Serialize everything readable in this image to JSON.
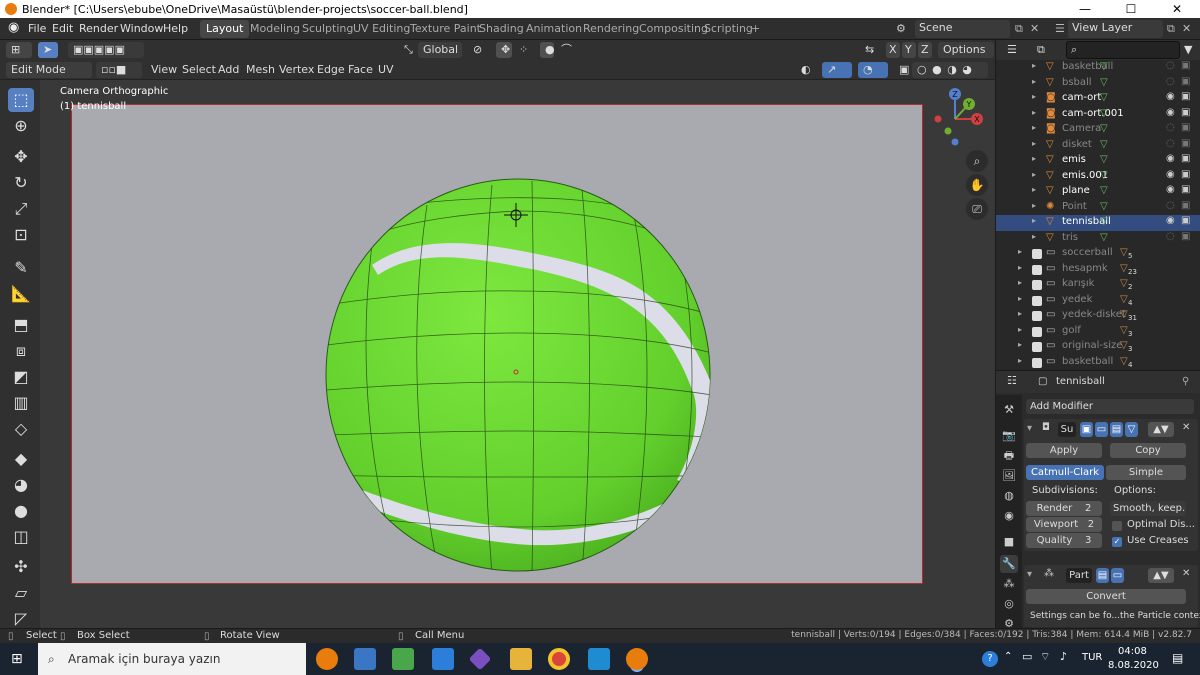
{
  "window": {
    "title": "Blender* [C:\\Users\\ebube\\OneDrive\\Masaüstü\\blender-projects\\soccer-ball.blend]",
    "controls": [
      "—",
      "☐",
      "✕"
    ]
  },
  "topbar": {
    "menus": [
      "File",
      "Edit",
      "Render",
      "Window",
      "Help"
    ],
    "workspaces": [
      "Layout",
      "Modeling",
      "Sculpting",
      "UV Editing",
      "Texture Paint",
      "Shading",
      "Animation",
      "Rendering",
      "Compositing",
      "Scripting"
    ],
    "active_workspace": "Layout",
    "add_workspace": "+",
    "scene": "Scene",
    "view_layer": "View Layer"
  },
  "viewport_header1": {
    "transform_orientation": "Global",
    "axis_x": "X",
    "axis_y": "Y",
    "axis_z": "Z",
    "options": "Options"
  },
  "viewport_header2": {
    "mode": "Edit Mode",
    "menus": [
      "View",
      "Select",
      "Add",
      "Mesh",
      "Vertex",
      "Edge",
      "Face",
      "UV"
    ]
  },
  "viewport": {
    "camera_label": "Camera Orthographic",
    "object_label": "(1) tennisball",
    "gizmo": {
      "x": "X",
      "y": "Y",
      "z": "Z"
    }
  },
  "outliner": {
    "search_placeholder": "",
    "rows": [
      {
        "name": "basketball",
        "type": "mesh",
        "visible": false,
        "badge": ""
      },
      {
        "name": "bsball",
        "type": "mesh",
        "visible": false,
        "badge": ""
      },
      {
        "name": "cam-ort",
        "type": "camera",
        "visible": true,
        "badge": ""
      },
      {
        "name": "cam-ort.001",
        "type": "camera",
        "visible": true,
        "badge": ""
      },
      {
        "name": "Camera",
        "type": "camera",
        "visible": false,
        "badge": ""
      },
      {
        "name": "disket",
        "type": "mesh",
        "visible": false,
        "badge": ""
      },
      {
        "name": "emis",
        "type": "mesh",
        "visible": true,
        "badge": ""
      },
      {
        "name": "emis.001",
        "type": "mesh",
        "visible": true,
        "badge": ""
      },
      {
        "name": "plane",
        "type": "mesh",
        "visible": true,
        "badge": ""
      },
      {
        "name": "Point",
        "type": "light",
        "visible": false,
        "badge": ""
      },
      {
        "name": "tennisball",
        "type": "mesh",
        "visible": true,
        "badge": "",
        "selected": true
      },
      {
        "name": "tris",
        "type": "mesh",
        "visible": false,
        "badge": ""
      },
      {
        "name": "soccerball",
        "type": "collection",
        "visible": false,
        "badge": "5"
      },
      {
        "name": "hesapmk",
        "type": "collection",
        "visible": false,
        "badge": "23"
      },
      {
        "name": "karışık",
        "type": "collection",
        "visible": false,
        "badge": "2"
      },
      {
        "name": "yedek",
        "type": "collection",
        "visible": false,
        "badge": "4"
      },
      {
        "name": "yedek-disket",
        "type": "collection",
        "visible": false,
        "badge": "31"
      },
      {
        "name": "golf",
        "type": "collection",
        "visible": false,
        "badge": "3"
      },
      {
        "name": "original-size",
        "type": "collection",
        "visible": false,
        "badge": "3"
      },
      {
        "name": "basketball",
        "type": "collection",
        "visible": false,
        "badge": "4"
      }
    ]
  },
  "properties": {
    "object_name": "tennisball",
    "add_modifier": "Add Modifier",
    "subsurf": {
      "name_short": "Su",
      "apply": "Apply",
      "copy": "Copy",
      "type_catmull": "Catmull-Clark",
      "type_simple": "Simple",
      "subdivisions_label": "Subdivisions:",
      "options_label": "Options:",
      "render_label": "Render",
      "render_value": "2",
      "viewport_label": "Viewport",
      "viewport_value": "2",
      "quality_label": "Quality",
      "quality_value": "3",
      "uv_smooth": "Smooth, keep...",
      "optimal_display": "Optimal Dis...",
      "use_creases": "Use Creases",
      "optimal_display_checked": false,
      "use_creases_checked": true
    },
    "particle": {
      "name_short": "Part",
      "convert": "Convert",
      "note": "Settings can be fo...the Particle contex"
    }
  },
  "statusbar": {
    "select": "Select",
    "box_select": "Box Select",
    "rotate_view": "Rotate View",
    "call_menu": "Call Menu",
    "stats": "tennisball | Verts:0/194 | Edges:0/384 | Faces:0/192 | Tris:384 | Mem: 614.4 MiB | v2.82.7"
  },
  "taskbar": {
    "search_placeholder": "Aramak için buraya yazın",
    "language": "TUR",
    "time": "04:08",
    "date": "8.08.2020"
  },
  "colors": {
    "accent_blue": "#4772b3",
    "camera_border": "#b32c2c",
    "ball_green": "#6fd638",
    "object_orange": "#e28a3c"
  }
}
